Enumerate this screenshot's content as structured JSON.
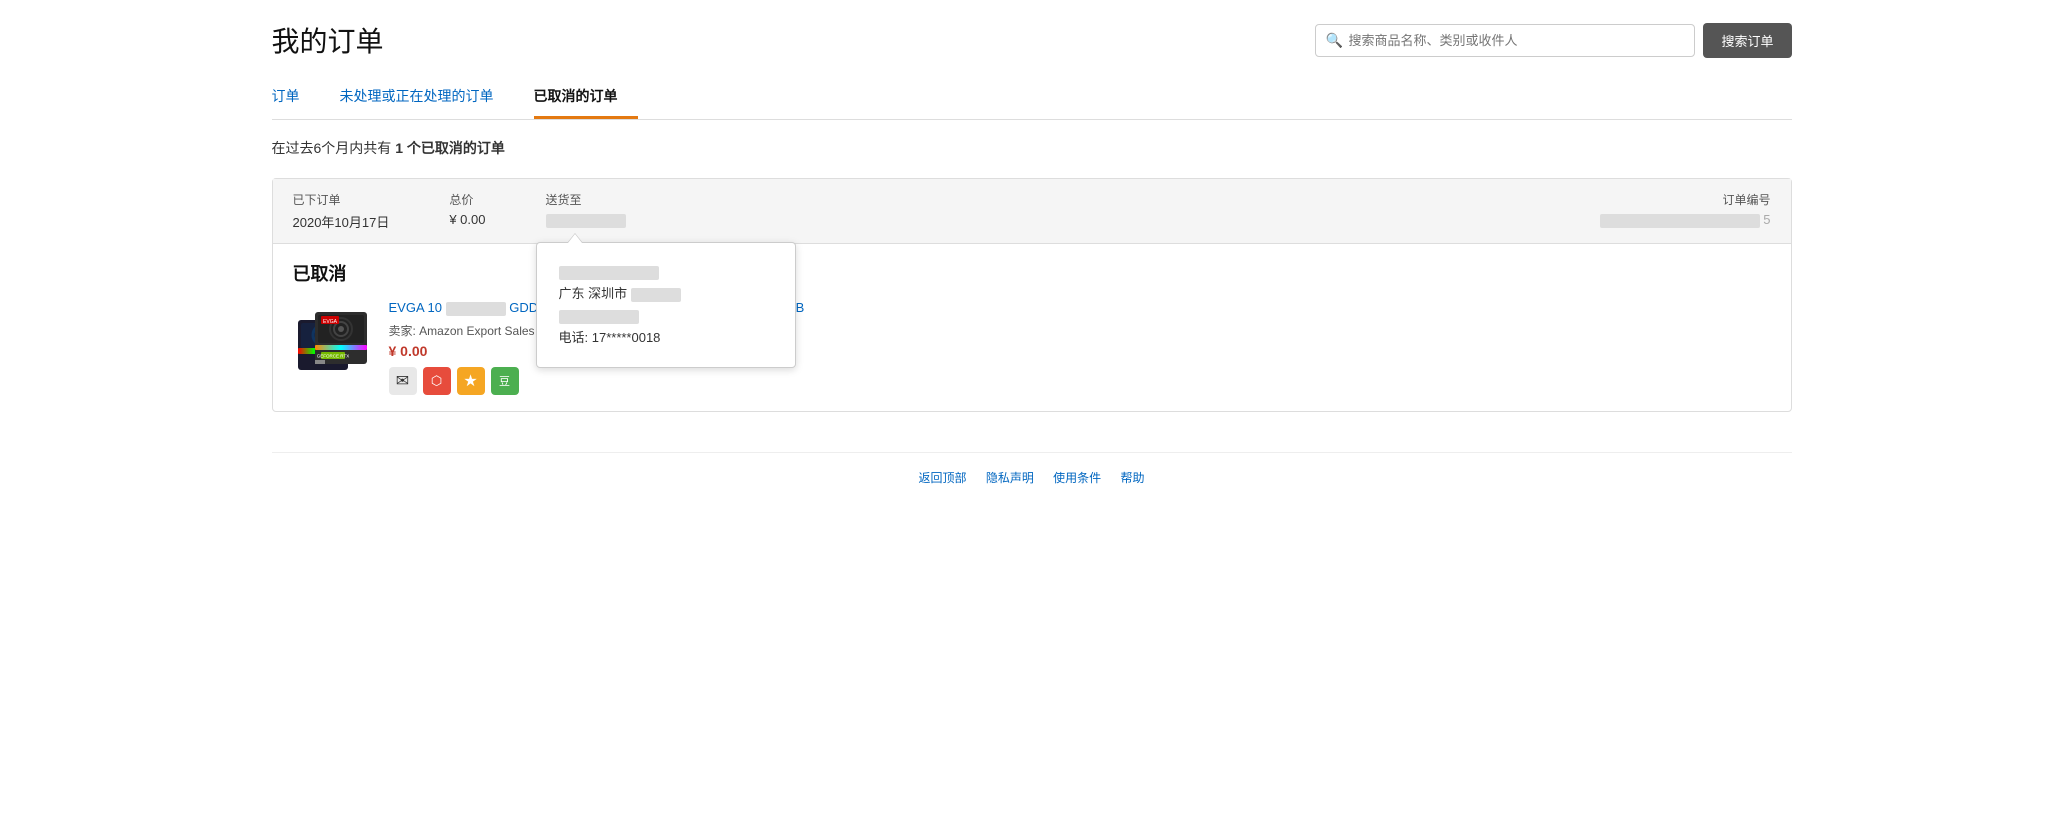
{
  "header": {
    "title": "我的订单",
    "search": {
      "placeholder": "搜索商品名称、类别或收件人",
      "button_label": "搜索订单"
    }
  },
  "tabs": [
    {
      "id": "orders",
      "label": "订单",
      "active": false
    },
    {
      "id": "pending",
      "label": "未处理或正在处理的订单",
      "active": false
    },
    {
      "id": "cancelled",
      "label": "已取消的订单",
      "active": true
    }
  ],
  "summary": {
    "prefix": "在过去6个月内共有 ",
    "count": "1 个已取消的订单",
    "suffix": ""
  },
  "order": {
    "date_label": "已下订单",
    "date_value": "2020年10月17日",
    "total_label": "总价",
    "total_value": "¥ 0.00",
    "shipping_label": "送货至",
    "shipping_name_blurred": true,
    "order_number_label": "订单编号",
    "order_number_suffix": "5",
    "status": "已取消",
    "tooltip": {
      "name_blurred": true,
      "city": "广东 深圳市",
      "address_blurred": true,
      "phone_label": "电话: ",
      "phone": "17*****0018"
    },
    "product": {
      "title_short": "EVGA 10",
      "title_part2": "GDDR6X",
      "title_full": "EVGA 10 GDDR6X V3 ULTRA GAMING,10GB",
      "title_end": "V3 ULTRA GAMING,10GB",
      "seller_label": "卖家: ",
      "seller": "Amazon Export Sales LLC",
      "price": "¥ 0.00",
      "icons": [
        {
          "id": "email",
          "symbol": "✉",
          "label": "email-icon"
        },
        {
          "id": "share",
          "symbol": "★",
          "label": "share-icon"
        },
        {
          "id": "star",
          "symbol": "☆",
          "label": "star-icon"
        },
        {
          "id": "bean",
          "symbol": "豆",
          "label": "bean-icon"
        }
      ]
    }
  },
  "footer": {
    "links": [
      "返回顶部",
      "隐私声明",
      "使用条件",
      "帮助"
    ]
  }
}
